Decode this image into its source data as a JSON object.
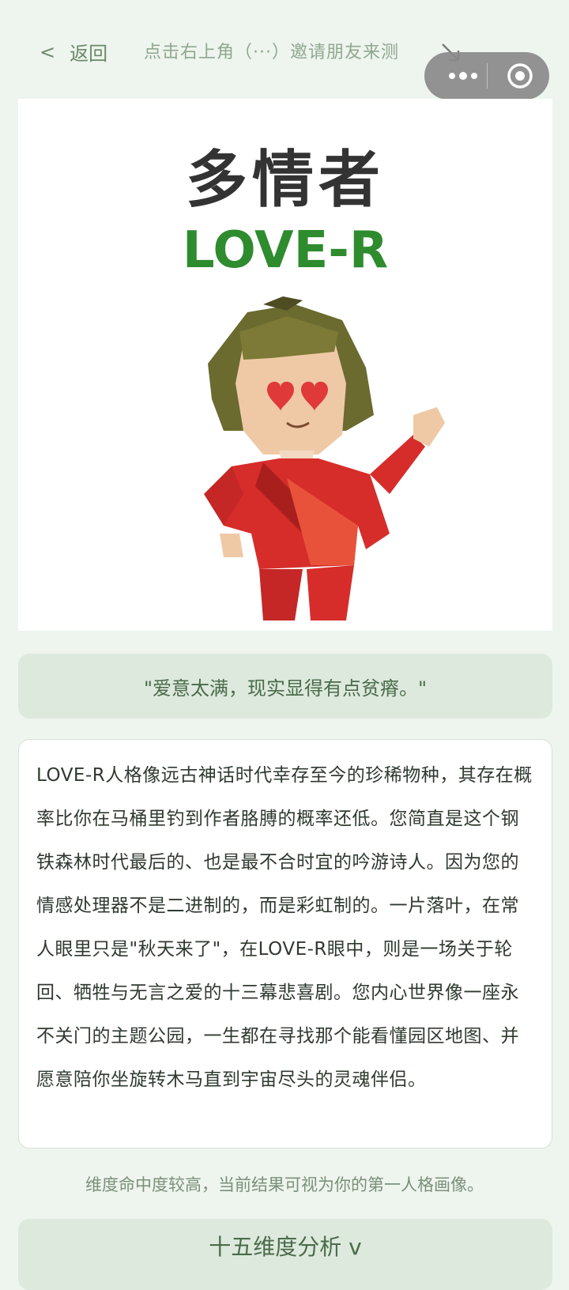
{
  "nav": {
    "back_chevron": "<",
    "back_label": "返回",
    "hint": "点击右上角（···）邀请朋友来测",
    "hint_arrow_icon": "arrow-down-right-icon",
    "menu_icon": "more-dots-icon",
    "close_icon": "target-circle-icon"
  },
  "hero": {
    "title": "多情者",
    "code": "LOVE-R",
    "figure_icon": "lowpoly-character-heart-eyes"
  },
  "quote": "\"爱意太满，现实显得有点贫瘠。\"",
  "description": "LOVE-R人格像远古神话时代幸存至今的珍稀物种，其存在概率比你在马桶里钓到作者胳膊的概率还低。您简直是这个钢铁森林时代最后的、也是最不合时宜的吟游诗人。因为您的情感处理器不是二进制的，而是彩虹制的。一片落叶，在常人眼里只是\"秋天来了\"，在LOVE-R眼中，则是一场关于轮回、牺牲与无言之爱的十三幕悲喜剧。您内心世界像一座永不关门的主题公园，一生都在寻找那个能看懂园区地图、并愿意陪你坐旋转木马直到宇宙尽头的灵魂伴侣。",
  "note": "维度命中度较高，当前结果可视为你的第一人格画像。",
  "dimensions_label": "十五维度分析 v",
  "colors": {
    "background": "#eef4ee",
    "accent_green": "#2e8b2e",
    "panel_green": "#dde9dd"
  }
}
